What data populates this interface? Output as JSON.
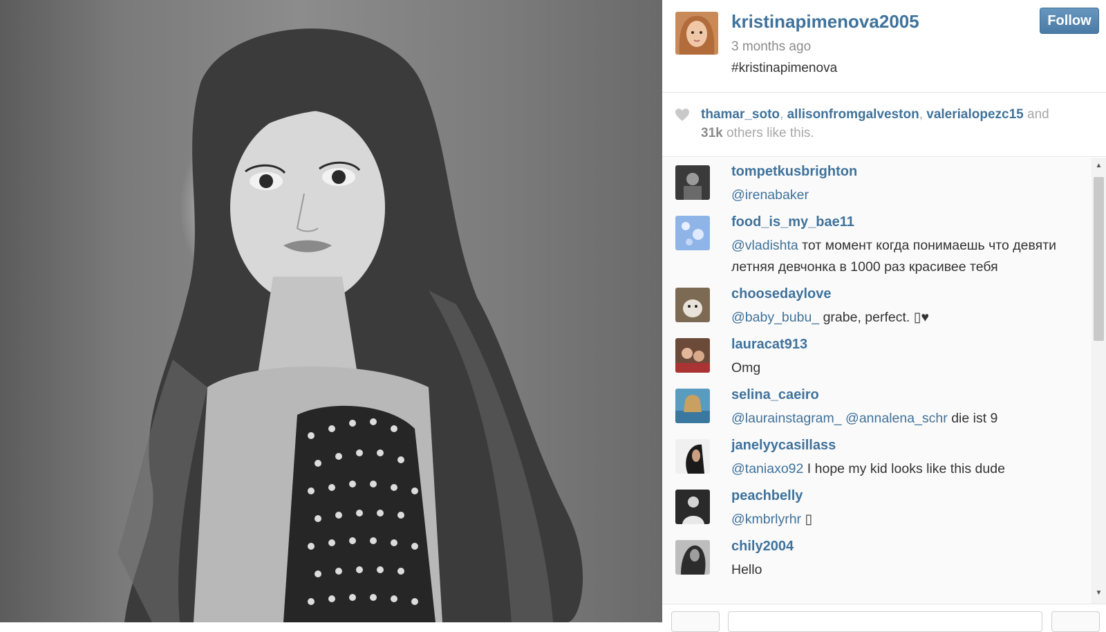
{
  "post": {
    "owner": "kristinapimenova2005",
    "time": "3 months ago",
    "caption": "#kristinapimenova",
    "follow_label": "Follow"
  },
  "likes": {
    "users": [
      "thamar_soto",
      "allisonfromgalveston",
      "valerialopezc15"
    ],
    "sep": ", ",
    "and": " and",
    "count": "31k",
    "suffix": " others like this."
  },
  "comments": [
    {
      "user": "tompetkusbrighton",
      "mentions": [
        "@irenabaker"
      ],
      "text": ""
    },
    {
      "user": "food_is_my_bae11",
      "mentions": [
        "@vladishta"
      ],
      "text": " тот момент когда понимаешь что девяти летняя девчонка в 1000 раз красивее тебя"
    },
    {
      "user": "choosedaylove",
      "mentions": [
        "@baby_bubu_"
      ],
      "text": " grabe, perfect. ▯♥"
    },
    {
      "user": "lauracat913",
      "mentions": [],
      "text": "Omg"
    },
    {
      "user": "selina_caeiro",
      "mentions": [
        "@laurainstagram_",
        "@annalena_schr"
      ],
      "text": " die ist 9"
    },
    {
      "user": "janelyycasillass",
      "mentions": [
        "@taniaxo92"
      ],
      "text": " I hope my kid looks like this dude"
    },
    {
      "user": "peachbelly",
      "mentions": [
        "@kmbrlyrhr"
      ],
      "text": " ▯"
    },
    {
      "user": "chily2004",
      "mentions": [],
      "text": "Hello"
    }
  ],
  "icons": {
    "heart": "heart-icon",
    "scroll_up": "scroll-up-arrow-icon",
    "scroll_down": "scroll-down-arrow-icon"
  },
  "colors": {
    "link": "#3f729b",
    "follow_button": "#4a7ba6",
    "muted": "#8b8b8b"
  }
}
